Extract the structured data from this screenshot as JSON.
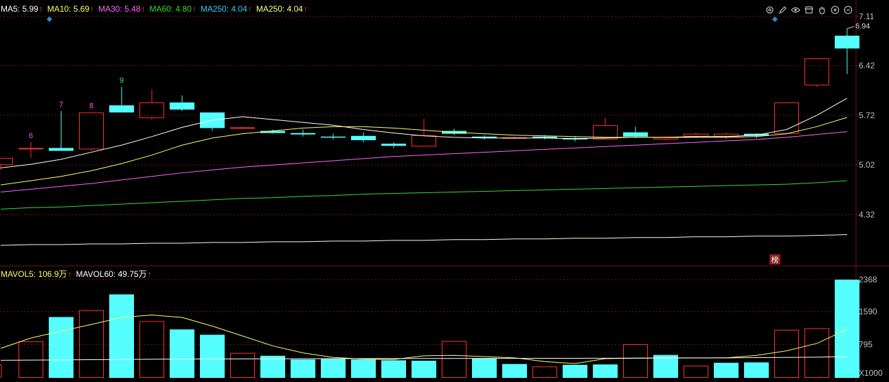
{
  "price_legend": [
    {
      "label": "MA5:",
      "value": "5.99",
      "color": "#ffffff"
    },
    {
      "label": "MA10:",
      "value": "5.69",
      "color": "#ffff66"
    },
    {
      "label": "MA30:",
      "value": "5.48",
      "color": "#ff66ff"
    },
    {
      "label": "MA60:",
      "value": "4.80",
      "color": "#33dd33"
    },
    {
      "label": "MA250:",
      "value": "4.04",
      "color": "#33ccff"
    },
    {
      "label": "MA250:",
      "value": "4.04",
      "color": "#ffff99"
    }
  ],
  "volume_legend": [
    {
      "label": "MAVOL5:",
      "value": "106.9万",
      "color": "#ffff66"
    },
    {
      "label": "MAVOL60:",
      "value": "49.75万",
      "color": "#ffffff"
    }
  ],
  "legend_arrow": "↑",
  "toolbar_icons": [
    "settings-icon",
    "pen-icon",
    "eye-icon",
    "store-icon",
    "hand-icon",
    "zoom-in-icon",
    "zoom-out-icon"
  ],
  "colors": {
    "up": "#ff3030",
    "down": "#55ffff",
    "grid": "#7a1515",
    "axis": "#c0c0c0"
  },
  "badge": "榜",
  "chart_data": [
    {
      "type": "candlestick",
      "title": "",
      "ylim": [
        3.62,
        7.11
      ],
      "y_ticks": [
        "7.11",
        "6.42",
        "5.72",
        "5.02",
        "4.32"
      ],
      "candles": [
        {
          "o": 5.02,
          "h": 5.12,
          "l": 4.95,
          "c": 5.12
        },
        {
          "o": 5.26,
          "h": 5.34,
          "l": 5.12,
          "c": 5.26
        },
        {
          "o": 5.26,
          "h": 5.78,
          "l": 5.24,
          "c": 5.22
        },
        {
          "o": 5.24,
          "h": 5.76,
          "l": 5.22,
          "c": 5.76
        },
        {
          "o": 5.86,
          "h": 6.12,
          "l": 5.76,
          "c": 5.76
        },
        {
          "o": 5.68,
          "h": 6.08,
          "l": 5.66,
          "c": 5.9
        },
        {
          "o": 5.9,
          "h": 6.0,
          "l": 5.78,
          "c": 5.8
        },
        {
          "o": 5.76,
          "h": 5.76,
          "l": 5.5,
          "c": 5.54
        },
        {
          "o": 5.55,
          "h": 5.56,
          "l": 5.54,
          "c": 5.55
        },
        {
          "o": 5.5,
          "h": 5.52,
          "l": 5.46,
          "c": 5.47
        },
        {
          "o": 5.47,
          "h": 5.52,
          "l": 5.42,
          "c": 5.45
        },
        {
          "o": 5.42,
          "h": 5.46,
          "l": 5.38,
          "c": 5.41
        },
        {
          "o": 5.43,
          "h": 5.48,
          "l": 5.34,
          "c": 5.37
        },
        {
          "o": 5.32,
          "h": 5.34,
          "l": 5.26,
          "c": 5.29
        },
        {
          "o": 5.28,
          "h": 5.67,
          "l": 5.27,
          "c": 5.44
        },
        {
          "o": 5.5,
          "h": 5.53,
          "l": 5.44,
          "c": 5.46
        },
        {
          "o": 5.42,
          "h": 5.44,
          "l": 5.38,
          "c": 5.4
        },
        {
          "o": 5.4,
          "h": 5.42,
          "l": 5.38,
          "c": 5.41
        },
        {
          "o": 5.42,
          "h": 5.44,
          "l": 5.38,
          "c": 5.4
        },
        {
          "o": 5.4,
          "h": 5.42,
          "l": 5.35,
          "c": 5.38
        },
        {
          "o": 5.38,
          "h": 5.68,
          "l": 5.37,
          "c": 5.58
        },
        {
          "o": 5.48,
          "h": 5.56,
          "l": 5.4,
          "c": 5.42
        },
        {
          "o": 5.38,
          "h": 5.42,
          "l": 5.36,
          "c": 5.41
        },
        {
          "o": 5.42,
          "h": 5.48,
          "l": 5.4,
          "c": 5.46
        },
        {
          "o": 5.42,
          "h": 5.48,
          "l": 5.38,
          "c": 5.46
        },
        {
          "o": 5.46,
          "h": 5.47,
          "l": 5.4,
          "c": 5.43
        },
        {
          "o": 5.46,
          "h": 5.91,
          "l": 5.45,
          "c": 5.9
        },
        {
          "o": 6.14,
          "h": 6.52,
          "l": 6.12,
          "c": 6.52
        },
        {
          "o": 6.84,
          "h": 6.94,
          "l": 6.3,
          "c": 6.66
        }
      ],
      "markers": [
        {
          "index": 1,
          "text": "6",
          "color": "#ff55ff"
        },
        {
          "index": 2,
          "text": "7",
          "color": "#ff55ff"
        },
        {
          "index": 3,
          "text": "8",
          "color": "#ff55ff"
        },
        {
          "index": 4,
          "text": "9",
          "color": "#33ff33"
        }
      ],
      "high_label": {
        "index": 28,
        "text": "6.94"
      },
      "series": [
        {
          "name": "MA5",
          "color": "#ffffff",
          "values": [
            4.98,
            5.03,
            5.1,
            5.2,
            5.3,
            5.42,
            5.55,
            5.65,
            5.7,
            5.66,
            5.62,
            5.58,
            5.52,
            5.47,
            5.43,
            5.41,
            5.4,
            5.4,
            5.4,
            5.39,
            5.4,
            5.41,
            5.41,
            5.42,
            5.42,
            5.44,
            5.52,
            5.72,
            5.96
          ]
        },
        {
          "name": "MA10",
          "color": "#ffff66",
          "values": [
            4.74,
            4.8,
            4.86,
            4.94,
            5.04,
            5.16,
            5.3,
            5.4,
            5.46,
            5.5,
            5.54,
            5.56,
            5.56,
            5.54,
            5.51,
            5.48,
            5.46,
            5.44,
            5.43,
            5.42,
            5.41,
            5.41,
            5.41,
            5.41,
            5.41,
            5.42,
            5.46,
            5.56,
            5.69
          ]
        },
        {
          "name": "MA30",
          "color": "#ff66ff",
          "values": [
            4.64,
            4.68,
            4.72,
            4.76,
            4.81,
            4.86,
            4.91,
            4.95,
            4.99,
            5.02,
            5.05,
            5.08,
            5.11,
            5.14,
            5.16,
            5.18,
            5.2,
            5.22,
            5.24,
            5.26,
            5.28,
            5.3,
            5.32,
            5.34,
            5.36,
            5.38,
            5.41,
            5.45,
            5.49
          ]
        },
        {
          "name": "MA60",
          "color": "#33dd33",
          "values": [
            4.4,
            4.42,
            4.43,
            4.45,
            4.47,
            4.49,
            4.51,
            4.53,
            4.55,
            4.56,
            4.58,
            4.59,
            4.61,
            4.62,
            4.63,
            4.64,
            4.65,
            4.66,
            4.67,
            4.68,
            4.69,
            4.7,
            4.71,
            4.72,
            4.73,
            4.74,
            4.75,
            4.77,
            4.8
          ]
        },
        {
          "name": "MA250",
          "color": "#ffffdd",
          "values": [
            3.89,
            3.9,
            3.9,
            3.91,
            3.91,
            3.92,
            3.92,
            3.93,
            3.93,
            3.94,
            3.94,
            3.95,
            3.95,
            3.96,
            3.96,
            3.97,
            3.97,
            3.98,
            3.98,
            3.99,
            3.99,
            4.0,
            4.0,
            4.01,
            4.01,
            4.02,
            4.02,
            4.03,
            4.04
          ]
        }
      ]
    },
    {
      "type": "bar",
      "title": "",
      "unit": "X1000",
      "ylim": [
        0,
        2368
      ],
      "y_ticks": [
        "2368",
        "1590",
        "795"
      ],
      "values": [
        870,
        1460,
        1630,
        2010,
        1360,
        1160,
        1030,
        590,
        520,
        430,
        440,
        430,
        410,
        400,
        880,
        450,
        320,
        260,
        300,
        310,
        800,
        540,
        280,
        350,
        360,
        1150,
        1190,
        2368
      ],
      "up": [
        true,
        false,
        true,
        false,
        true,
        false,
        false,
        true,
        false,
        false,
        false,
        false,
        false,
        false,
        true,
        false,
        false,
        true,
        false,
        false,
        true,
        false,
        true,
        false,
        false,
        true,
        true,
        false
      ],
      "series": [
        {
          "name": "MAVOL5",
          "color": "#ffff66",
          "values": [
            700,
            950,
            1120,
            1280,
            1450,
            1510,
            1450,
            1240,
            1000,
            760,
            590,
            480,
            440,
            430,
            520,
            530,
            500,
            470,
            380,
            330,
            450,
            460,
            470,
            470,
            470,
            530,
            640,
            820,
            1160
          ]
        },
        {
          "name": "MAVOL60",
          "color": "#ffffff",
          "values": [
            410,
            415,
            420,
            425,
            430,
            435,
            440,
            442,
            444,
            446,
            448,
            450,
            452,
            452,
            454,
            455,
            456,
            457,
            458,
            459,
            460,
            462,
            464,
            466,
            470,
            475,
            480,
            485,
            500
          ]
        }
      ]
    }
  ]
}
